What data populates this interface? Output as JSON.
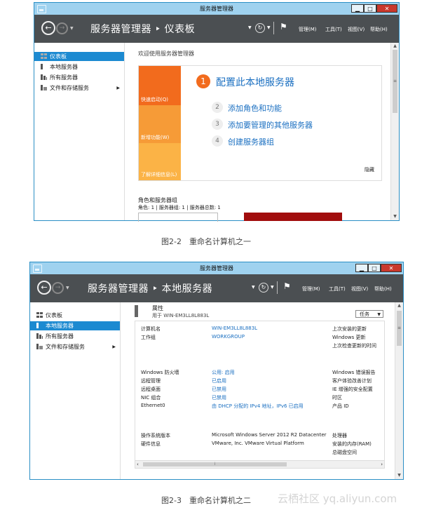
{
  "fig1": {
    "title": "服务器管理器",
    "breadcrumb": "服务器管理器 ‣ 仪表板",
    "menu": [
      "管理(M)",
      "工具(T)",
      "视图(V)",
      "帮助(H)"
    ],
    "sidebar": [
      "仪表板",
      "本地服务器",
      "所有服务器",
      "文件和存储服务"
    ],
    "welcome": "欢迎使用服务器管理器",
    "tiles": [
      "快速启动(Q)",
      "新增功能(W)",
      "了解详细信息(L)"
    ],
    "step1_num": "1",
    "step1": "配置此本地服务器",
    "steps": [
      {
        "num": "2",
        "text": "添加角色和功能"
      },
      {
        "num": "3",
        "text": "添加要管理的其他服务器"
      },
      {
        "num": "4",
        "text": "创建服务器组"
      }
    ],
    "hide": "隐藏",
    "roles_title": "角色和服务器组",
    "roles_sub": "角色: 1 | 服务器组: 1 | 服务器总数: 1",
    "caption": "图2-2　重命名计算机之一"
  },
  "fig2": {
    "title": "服务器管理器",
    "breadcrumb": "服务器管理器 ‣ 本地服务器",
    "menu": [
      "管理(M)",
      "工具(T)",
      "视图(V)",
      "帮助(H)"
    ],
    "sidebar": [
      "仪表板",
      "本地服务器",
      "所有服务器",
      "文件和存储服务"
    ],
    "props_title": "属性",
    "props_sub": "用于 WIN-EM3LL8L883L",
    "tasks": "任务",
    "group1": [
      {
        "label": "计算机名",
        "value": "WIN-EM3LL8L883L",
        "right": "上次安装的更新"
      },
      {
        "label": "工作组",
        "value": "WORKGROUP",
        "right": "Windows 更新"
      },
      {
        "label": "",
        "value": "",
        "right": "上次检查更新的时间"
      }
    ],
    "group2": [
      {
        "label": "Windows 防火墙",
        "value": "公用: 启用",
        "right": "Windows 错误报告"
      },
      {
        "label": "远程管理",
        "value": "已启用",
        "right": "客户体验改善计划"
      },
      {
        "label": "远程桌面",
        "value": "已禁用",
        "right": "IE 增强的安全配置"
      },
      {
        "label": "NIC 组合",
        "value": "已禁用",
        "right": "时区"
      },
      {
        "label": "Ethernet0",
        "value": "由 DHCP 分配的 IPv4 地址，IPv6 已启用",
        "right": "产品 ID"
      }
    ],
    "group3": [
      {
        "label": "操作系统版本",
        "value": "Microsoft Windows Server 2012 R2 Datacenter",
        "right": "处理器"
      },
      {
        "label": "硬件信息",
        "value": "VMware, Inc. VMware Virtual Platform",
        "right": "安装的内存(RAM)"
      },
      {
        "label": "",
        "value": "",
        "right": "总磁盘空间"
      }
    ],
    "caption": "图2-3　重命名计算机之二"
  },
  "watermark": "云栖社区 yq.aliyun.com",
  "colors": {
    "titlebar": "#9fd2ef",
    "header": "#4b4f52",
    "accent": "#1c8ad1",
    "orange_dark": "#f26b1d",
    "orange": "#f69b37",
    "orange_light": "#fbb346",
    "red_bar": "#a10d0d"
  }
}
